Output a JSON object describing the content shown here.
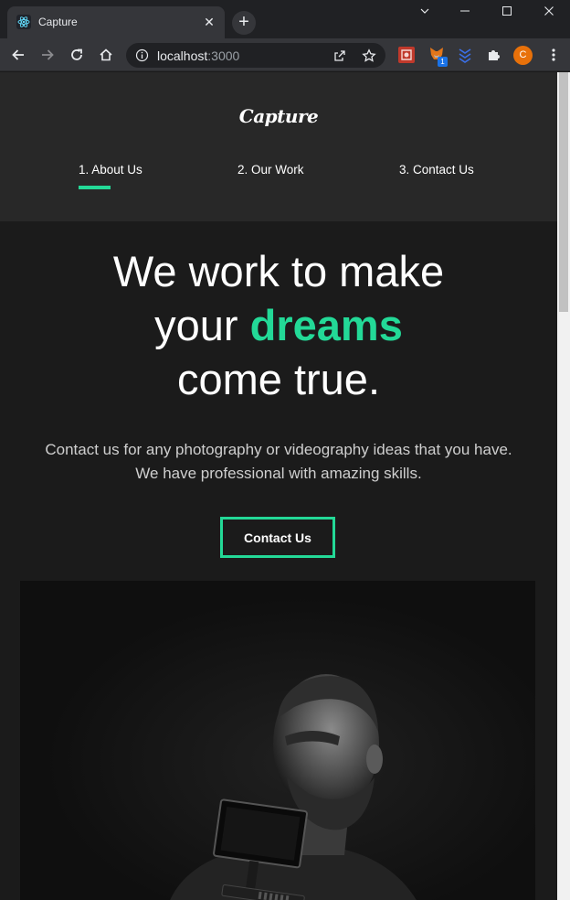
{
  "browser": {
    "tab_title": "Capture",
    "tab_close": "✕",
    "new_tab": "+",
    "url_host": "localhost",
    "url_port": ":3000",
    "profile_initial": "C",
    "extension_badge": "1"
  },
  "site": {
    "logo": "Capture",
    "nav": [
      {
        "label": "1. About Us"
      },
      {
        "label": "2. Our Work"
      },
      {
        "label": "3. Contact Us"
      }
    ],
    "accent_color": "#23d997"
  },
  "hero": {
    "line1": "We work to make",
    "line2_pre": "your ",
    "line2_accent": "dreams",
    "line3": "come true.",
    "description_line1": "Contact us for any photography or videography ideas that you have.",
    "description_line2": "We have professional with amazing skills.",
    "cta_label": "Contact Us"
  }
}
